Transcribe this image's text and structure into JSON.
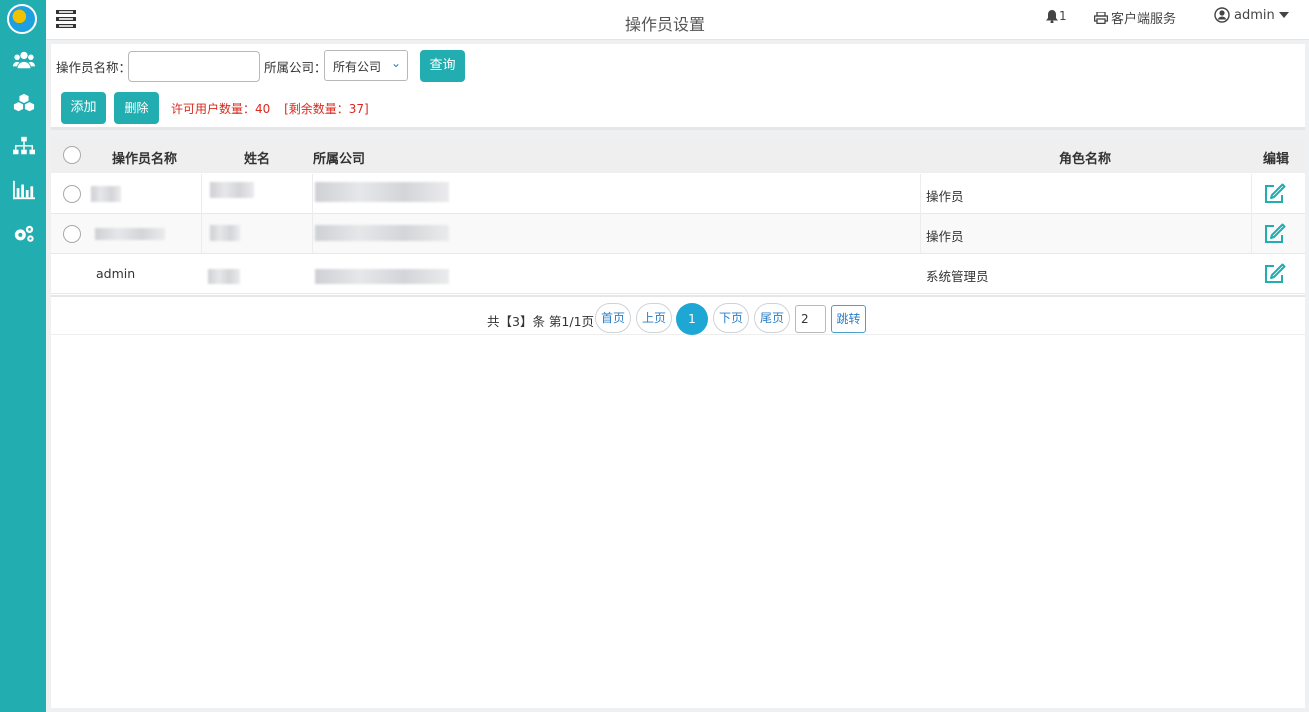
{
  "header": {
    "title": "操作员设置",
    "notifications": "1",
    "service_label": "客户端服务",
    "user": "admin"
  },
  "filters": {
    "name_label": "操作员名称：",
    "name_value": "",
    "company_label": "所属公司：",
    "company_selected": "所有公司",
    "query_label": "查询"
  },
  "actions": {
    "add_label": "添加",
    "delete_label": "删除",
    "license_text": "许可用户数量：40",
    "remaining_text": "[剩余数量：37]"
  },
  "table": {
    "columns": [
      "操作员名称",
      "姓名",
      "所属公司",
      "角色名称",
      "编辑"
    ],
    "rows": [
      {
        "name": "",
        "fullname": "",
        "company": "",
        "role": "操作员"
      },
      {
        "name": "",
        "fullname": "",
        "company": "",
        "role": "操作员"
      },
      {
        "name": "admin",
        "fullname": "",
        "company": "",
        "role": "系统管理员"
      }
    ]
  },
  "pagination": {
    "summary": "共【3】条 第1/1页",
    "first": "首页",
    "prev": "上页",
    "current": "1",
    "next": "下页",
    "last": "尾页",
    "jump_value": "2",
    "jump_label": "跳转"
  },
  "colors": {
    "accent": "#22aeb0",
    "warning": "#d9291e",
    "link": "#2a7ec8"
  },
  "icons": {
    "sidebar": [
      "users-icon",
      "cubes-icon",
      "sitemap-icon",
      "bar-chart-icon",
      "cogs-icon"
    ]
  }
}
